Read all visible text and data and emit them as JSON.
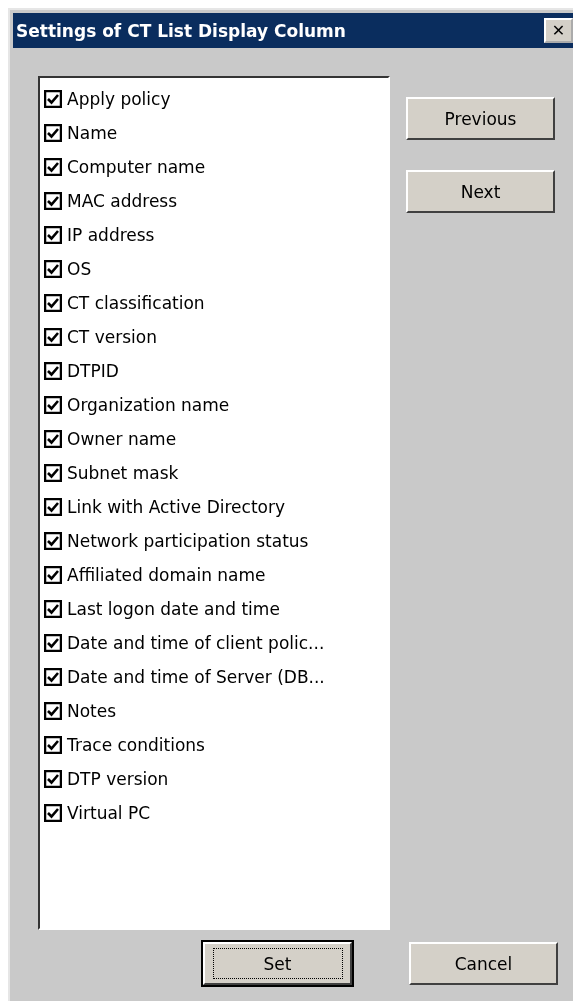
{
  "window": {
    "title": "Settings of CT List Display Column",
    "close": "✕"
  },
  "columns": [
    {
      "label": "Apply policy",
      "checked": true
    },
    {
      "label": "Name",
      "checked": true
    },
    {
      "label": "Computer name",
      "checked": true
    },
    {
      "label": "MAC address",
      "checked": true
    },
    {
      "label": "IP address",
      "checked": true
    },
    {
      "label": "OS",
      "checked": true
    },
    {
      "label": "CT classification",
      "checked": true
    },
    {
      "label": "CT version",
      "checked": true
    },
    {
      "label": "DTPID",
      "checked": true
    },
    {
      "label": "Organization name",
      "checked": true
    },
    {
      "label": "Owner name",
      "checked": true
    },
    {
      "label": "Subnet mask",
      "checked": true
    },
    {
      "label": "Link with Active Directory",
      "checked": true
    },
    {
      "label": "Network participation status",
      "checked": true
    },
    {
      "label": "Affiliated domain name",
      "checked": true
    },
    {
      "label": "Last logon date and time",
      "checked": true
    },
    {
      "label": "Date and time of client polic...",
      "checked": true
    },
    {
      "label": "Date and time of Server (DB...",
      "checked": true
    },
    {
      "label": "Notes",
      "checked": true
    },
    {
      "label": "Trace conditions",
      "checked": true
    },
    {
      "label": "DTP version",
      "checked": true
    },
    {
      "label": "Virtual PC",
      "checked": true
    }
  ],
  "side_buttons": [
    {
      "label": "Previous",
      "default": false
    },
    {
      "label": "Next",
      "default": false
    }
  ],
  "bottom_buttons": [
    {
      "label": "Set",
      "default": true
    },
    {
      "label": "Cancel",
      "default": false
    }
  ]
}
